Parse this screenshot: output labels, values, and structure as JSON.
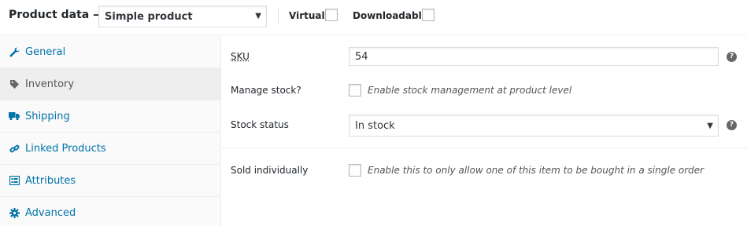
{
  "header": {
    "title": "Product data —",
    "product_type": "Simple product",
    "virtual_label": "Virtual:",
    "downloadable_label": "Downloadable:"
  },
  "tabs": [
    {
      "label": "General",
      "icon": "wrench-icon"
    },
    {
      "label": "Inventory",
      "icon": "tag-icon",
      "active": true
    },
    {
      "label": "Shipping",
      "icon": "truck-icon"
    },
    {
      "label": "Linked Products",
      "icon": "link-icon"
    },
    {
      "label": "Attributes",
      "icon": "list-icon"
    },
    {
      "label": "Advanced",
      "icon": "gear-icon"
    }
  ],
  "inventory": {
    "sku_label": "SKU",
    "sku_value": "54",
    "manage_stock_label": "Manage stock?",
    "manage_stock_desc": "Enable stock management at product level",
    "stock_status_label": "Stock status",
    "stock_status_value": "In stock",
    "sold_individually_label": "Sold individually",
    "sold_individually_desc": "Enable this to only allow one of this item to be bought in a single order"
  },
  "colors": {
    "link": "#0073aa",
    "active_tab_bg": "#eeeeee",
    "sidebar_bg": "#fafafa"
  }
}
